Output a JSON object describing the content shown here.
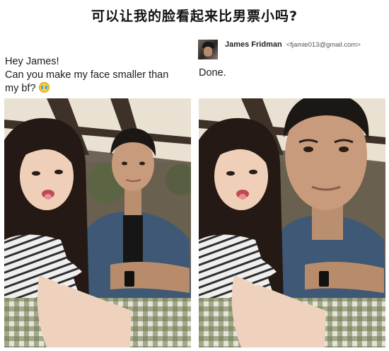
{
  "headline": "可以让我的脸看起来比男票小吗?",
  "request": {
    "line1": "Hey James!",
    "line2": "Can you make my face smaller than",
    "line3": "my bf?"
  },
  "reply": {
    "name": "James Fridman",
    "email": "<fjamie013@gmail.com>",
    "body": "Done."
  },
  "photos": [
    {
      "label": "original selfie",
      "boy_face_scale": 1.0
    },
    {
      "label": "edited selfie",
      "boy_face_scale": 1.75
    }
  ],
  "icons": {
    "emoji": "crying-laughing-emoji-icon",
    "avatar": "sender-avatar"
  }
}
